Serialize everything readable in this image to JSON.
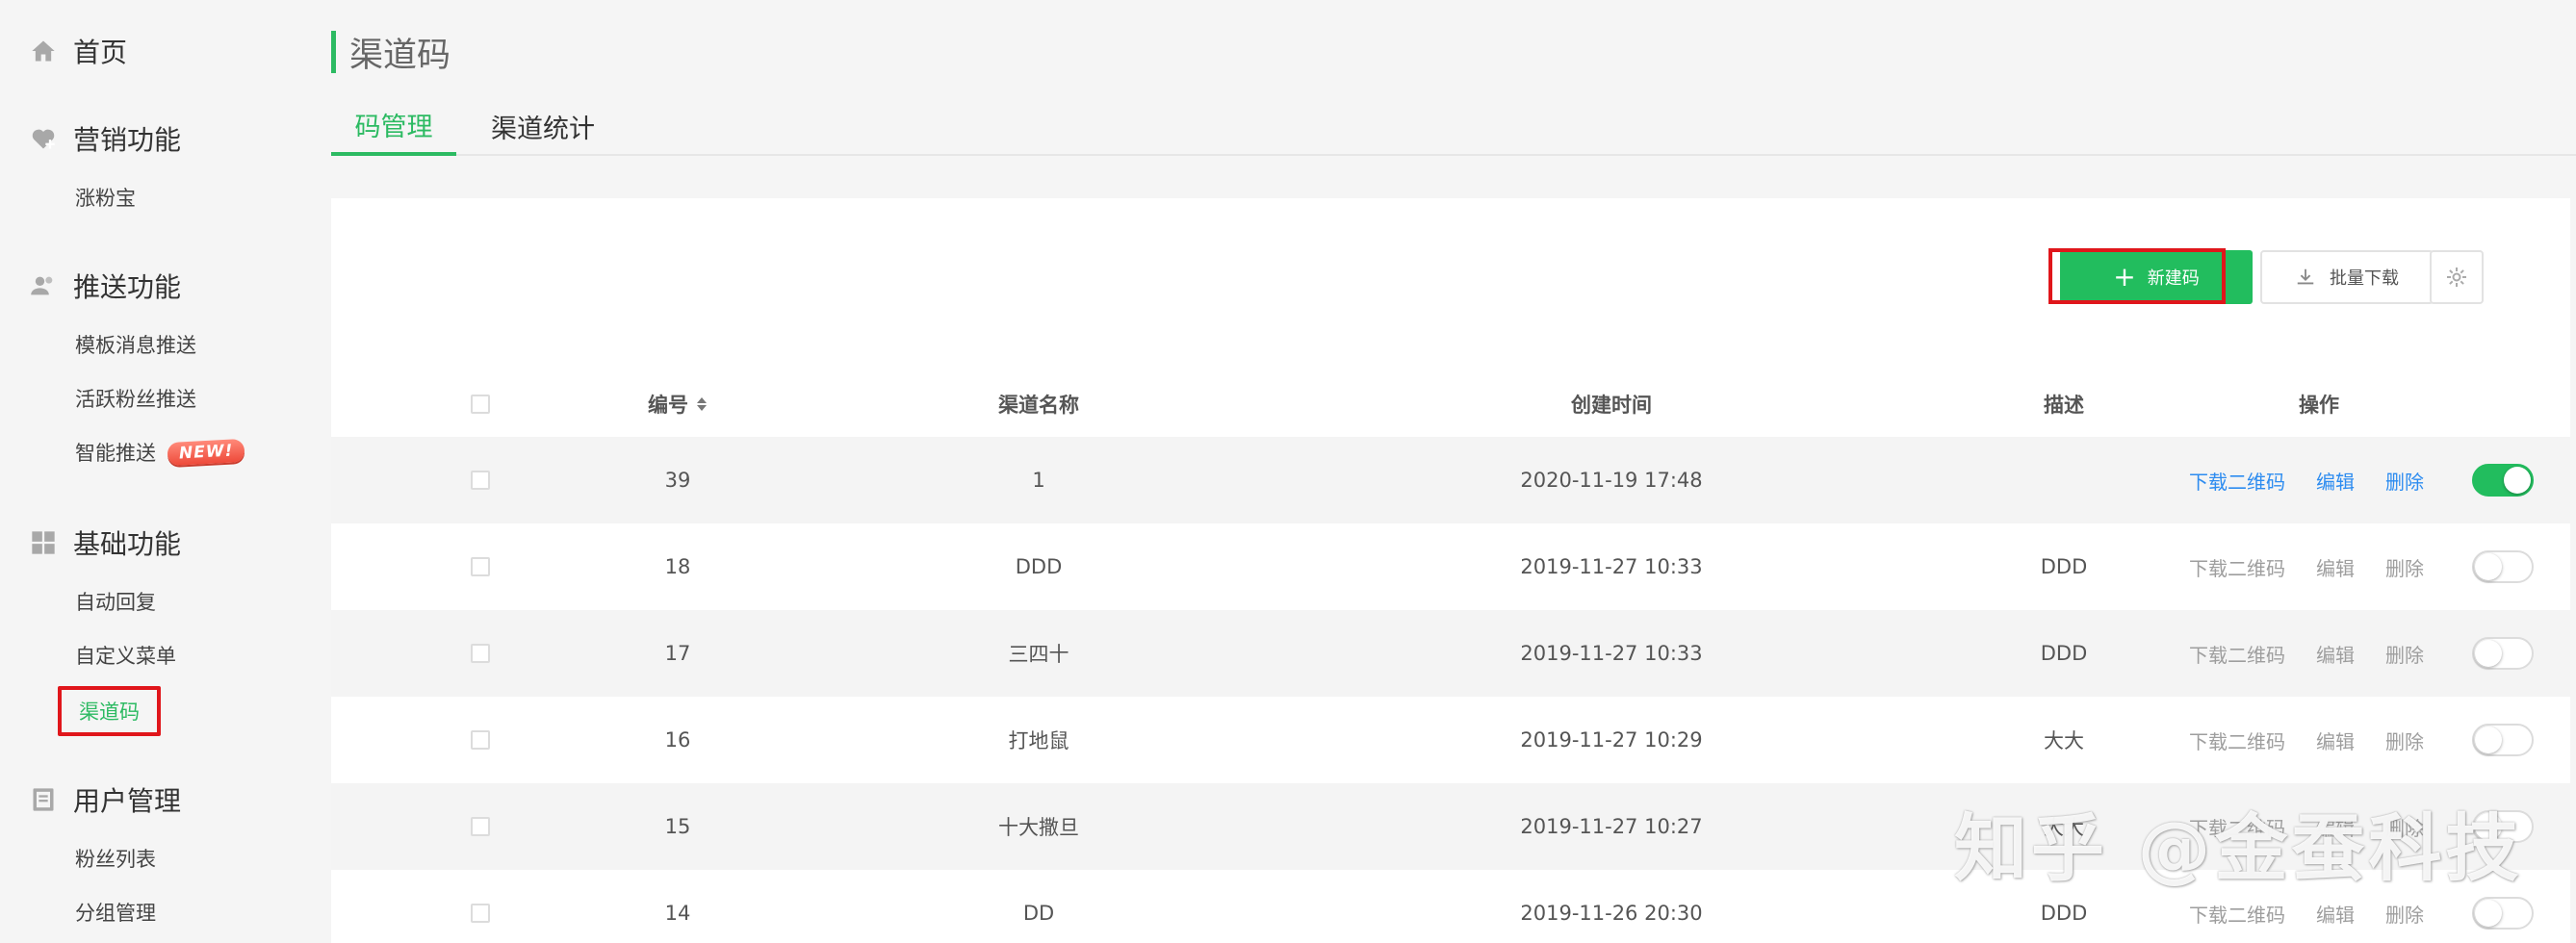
{
  "sidebar": {
    "home": "首页",
    "groups": [
      {
        "label": "营销功能",
        "icon": "heart-plus-icon",
        "items": [
          {
            "label": "涨粉宝"
          }
        ]
      },
      {
        "label": "推送功能",
        "icon": "users-icon",
        "items": [
          {
            "label": "模板消息推送"
          },
          {
            "label": "活跃粉丝推送"
          },
          {
            "label": "智能推送",
            "badge": "NEW!"
          }
        ]
      },
      {
        "label": "基础功能",
        "icon": "grid-icon",
        "items": [
          {
            "label": "自动回复"
          },
          {
            "label": "自定义菜单"
          },
          {
            "label": "渠道码",
            "active": true
          }
        ]
      },
      {
        "label": "用户管理",
        "icon": "user-card-icon",
        "items": [
          {
            "label": "粉丝列表"
          },
          {
            "label": "分组管理"
          }
        ]
      }
    ]
  },
  "page": {
    "title": "渠道码",
    "tabs": [
      {
        "label": "码管理",
        "active": true
      },
      {
        "label": "渠道统计"
      }
    ]
  },
  "toolbar": {
    "new_label": "新建码",
    "batch_download_label": "批量下载"
  },
  "table": {
    "headers": {
      "id": "编号",
      "name": "渠道名称",
      "created": "创建时间",
      "desc": "描述",
      "ops": "操作"
    },
    "op_labels": {
      "download": "下载二维码",
      "edit": "编辑",
      "delete": "删除"
    },
    "rows": [
      {
        "id": "39",
        "name": "1",
        "created": "2020-11-19 17:48",
        "desc": "",
        "enabled": true
      },
      {
        "id": "18",
        "name": "DDD",
        "created": "2019-11-27 10:33",
        "desc": "DDD",
        "enabled": false
      },
      {
        "id": "17",
        "name": "三四十",
        "created": "2019-11-27 10:33",
        "desc": "DDD",
        "enabled": false
      },
      {
        "id": "16",
        "name": "打地鼠",
        "created": "2019-11-27 10:29",
        "desc": "大大",
        "enabled": false
      },
      {
        "id": "15",
        "name": "十大撒旦",
        "created": "2019-11-27 10:27",
        "desc": "大大",
        "enabled": false
      },
      {
        "id": "14",
        "name": "DD",
        "created": "2019-11-26 20:30",
        "desc": "DDD",
        "enabled": false
      }
    ]
  },
  "watermark": "知乎 @金蚕科技",
  "colors": {
    "accent": "#22bd5e",
    "link": "#2d8cf0",
    "highlight": "#e0161b"
  }
}
